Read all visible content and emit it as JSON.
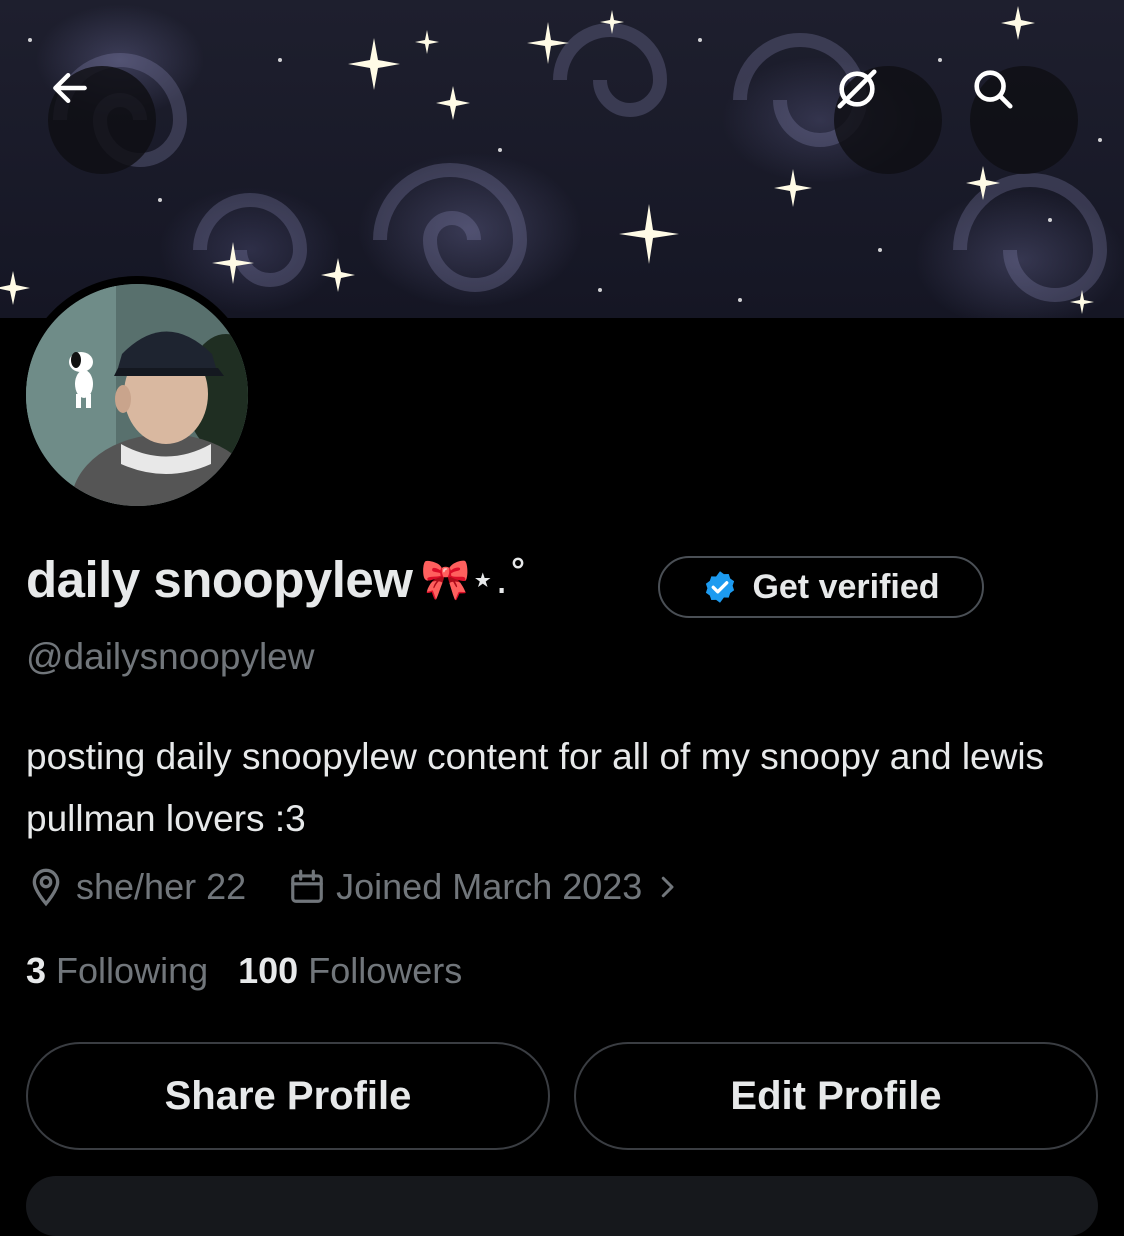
{
  "header": {
    "back_icon": "arrow-left-icon",
    "grok_icon": "slashed-circle-icon",
    "search_icon": "search-icon"
  },
  "profile": {
    "display_name": "daily snoopylew",
    "name_decoration": "🎀⋆.˚",
    "handle": "@dailysnoopylew",
    "bio": "posting daily snoopylew content for all of my snoopy and lewis pullman lovers :3",
    "location": "she/her 22",
    "joined": "Joined March 2023"
  },
  "verify": {
    "label": "Get verified",
    "badge_color": "#1d9bf0"
  },
  "stats": {
    "following_count": "3",
    "following_label": "Following",
    "followers_count": "100",
    "followers_label": "Followers"
  },
  "actions": {
    "share_label": "Share Profile",
    "edit_label": "Edit Profile"
  },
  "colors": {
    "background": "#000000",
    "text_primary": "#e7e9ea",
    "text_secondary": "#71767b",
    "accent": "#1d9bf0"
  }
}
